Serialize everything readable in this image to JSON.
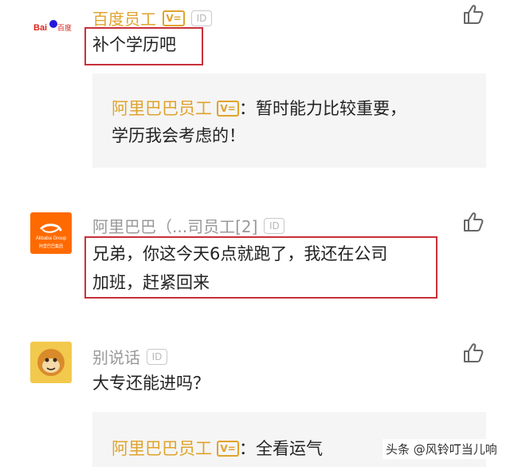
{
  "comments": [
    {
      "author": "百度员工",
      "avatar_text": "Bai 百度",
      "text_lines": [
        "补个学历吧"
      ],
      "reply": {
        "author": "阿里巴巴员工",
        "colon": "：",
        "lines": [
          "暂时能力比较重要，",
          "学历我会考虑的！"
        ]
      }
    },
    {
      "author": "阿里巴巴（...司员工[2]",
      "avatar_text": "Alibaba Group",
      "avatar_sub": "阿里巴巴集团",
      "text_lines": [
        "兄弟，你这今天6点就跑了，我还在公司",
        "加班，赶紧回来"
      ]
    },
    {
      "author": "别说话",
      "text_lines": [
        "大专还能进吗？"
      ],
      "reply": {
        "author": "阿里巴巴员工",
        "colon": "：",
        "lines": [
          "全看运气"
        ]
      }
    }
  ],
  "badges": {
    "v": "V=",
    "id": "ID"
  },
  "colors": {
    "accent": "#e0a32d",
    "highlight": "#c8303a",
    "alibaba_orange": "#ff6a00"
  },
  "icons": {
    "like": "thumbs-up-icon"
  },
  "watermark": "头条 @风铃叮当儿响"
}
